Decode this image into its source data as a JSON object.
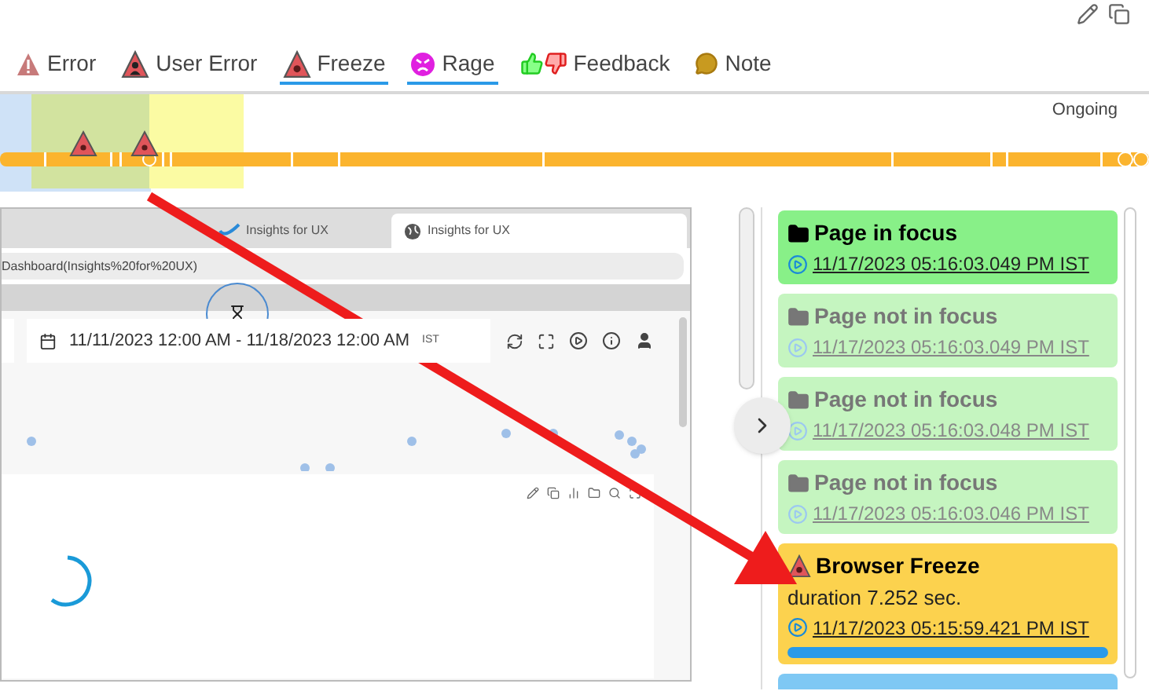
{
  "filters": [
    {
      "kind": "error",
      "label": "Error",
      "selected": false
    },
    {
      "kind": "user_error",
      "label": "User Error",
      "selected": false
    },
    {
      "kind": "freeze",
      "label": "Freeze",
      "selected": true
    },
    {
      "kind": "rage",
      "label": "Rage",
      "selected": true
    },
    {
      "kind": "feedback",
      "label": "Feedback",
      "selected": false
    },
    {
      "kind": "note",
      "label": "Note",
      "selected": false
    }
  ],
  "timeline": {
    "status": "Ongoing"
  },
  "replay": {
    "tabs": [
      {
        "label": "Insights for UX",
        "selected": false
      },
      {
        "label": "Insights for UX",
        "selected": true
      }
    ],
    "url": "Dashboard(Insights%20for%20UX)",
    "date_range": "11/11/2023 12:00 AM - 11/18/2023 12:00 AM",
    "timezone": "IST"
  },
  "events": [
    {
      "kind": "focus",
      "title": "Page in focus",
      "time": "11/17/2023 05:16:03.049 PM IST"
    },
    {
      "kind": "blur",
      "title": "Page not in focus",
      "time": "11/17/2023 05:16:03.049 PM IST"
    },
    {
      "kind": "blur",
      "title": "Page not in focus",
      "time": "11/17/2023 05:16:03.048 PM IST"
    },
    {
      "kind": "blur",
      "title": "Page not in focus",
      "time": "11/17/2023 05:16:03.046 PM IST"
    },
    {
      "kind": "freeze",
      "title": "Browser Freeze",
      "detail": "duration 7.252 sec.",
      "time": "11/17/2023 05:15:59.421 PM IST",
      "level": 1
    }
  ]
}
